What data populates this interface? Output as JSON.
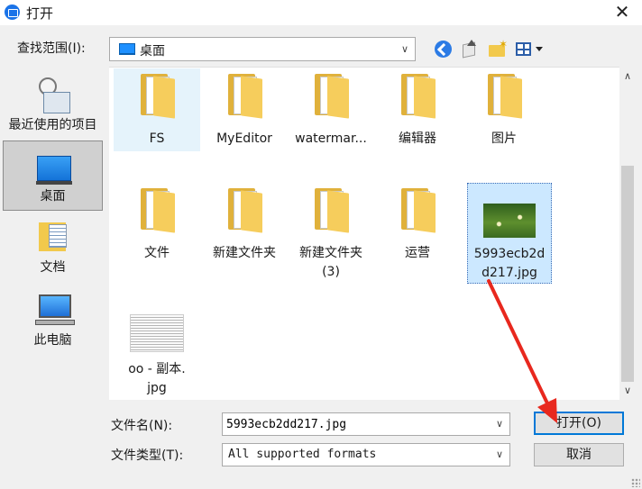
{
  "window": {
    "title": "打开",
    "close_glyph": "✕"
  },
  "look_in": {
    "label": "查找范围(I):",
    "value": "桌面"
  },
  "toolbar": {
    "back_icon": "back-icon",
    "up_icon": "up-folder-icon",
    "new_folder_icon": "new-folder-icon",
    "view_icon": "view-menu-icon"
  },
  "places": [
    {
      "label": "最近使用的项目",
      "icon": "recent-items-icon"
    },
    {
      "label": "桌面",
      "icon": "desktop-icon",
      "selected": true
    },
    {
      "label": "文档",
      "icon": "documents-icon"
    },
    {
      "label": "此电脑",
      "icon": "this-pc-icon"
    }
  ],
  "files": [
    {
      "label": "FS",
      "type": "folder"
    },
    {
      "label": "MyEditor",
      "type": "folder"
    },
    {
      "label": "watermar...",
      "type": "folder"
    },
    {
      "label": "编辑器",
      "type": "folder"
    },
    {
      "label": "图片",
      "type": "folder"
    },
    {
      "label": "文件",
      "type": "folder"
    },
    {
      "label": "新建文件夹",
      "type": "folder"
    },
    {
      "label": "新建文件夹",
      "label2": "(3)",
      "type": "folder"
    },
    {
      "label": "运营",
      "type": "folder"
    },
    {
      "label": "5993ecb2d",
      "label2": "d217.jpg",
      "type": "image",
      "selected": true
    },
    {
      "label": "oo - 副本.",
      "label2": "jpg",
      "type": "image"
    }
  ],
  "filename": {
    "label": "文件名(N):",
    "value": "5993ecb2dd217.jpg"
  },
  "filetype": {
    "label": "文件类型(T):",
    "value": "All supported formats"
  },
  "buttons": {
    "open": "打开(O)",
    "cancel": "取消"
  },
  "colors": {
    "accent": "#0078d7",
    "selection": "#cce8ff",
    "annotation": "#e8281e"
  }
}
